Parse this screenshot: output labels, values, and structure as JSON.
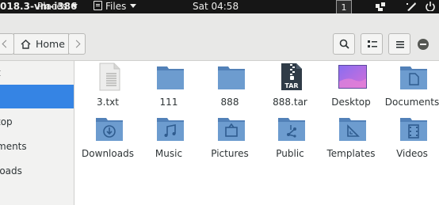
{
  "topbar": {
    "window_title": "018.3-vm-i386",
    "places_label": "Places",
    "files_label": "Files",
    "clock": "Sat 04:58",
    "workspace": "1"
  },
  "header": {
    "path_home": "Home"
  },
  "sidebar": {
    "items": [
      {
        "label": "t",
        "selected": false
      },
      {
        "label": "",
        "selected": true
      },
      {
        "label": "top",
        "selected": false
      },
      {
        "label": "ments",
        "selected": false
      },
      {
        "label": "loads",
        "selected": false
      }
    ]
  },
  "files": [
    {
      "name": "3.txt",
      "icon": "text-file-icon"
    },
    {
      "name": "111",
      "icon": "folder-icon"
    },
    {
      "name": "888",
      "icon": "folder-icon"
    },
    {
      "name": "888.tar",
      "icon": "tar-archive-icon"
    },
    {
      "name": "Desktop",
      "icon": "desktop-folder-icon"
    },
    {
      "name": "Documents",
      "icon": "documents-folder-icon"
    },
    {
      "name": "Downloads",
      "icon": "downloads-folder-icon"
    },
    {
      "name": "Music",
      "icon": "music-folder-icon"
    },
    {
      "name": "Pictures",
      "icon": "pictures-folder-icon"
    },
    {
      "name": "Public",
      "icon": "public-folder-icon"
    },
    {
      "name": "Templates",
      "icon": "templates-folder-icon"
    },
    {
      "name": "Videos",
      "icon": "videos-folder-icon"
    }
  ],
  "colors": {
    "folder": "#6d9ccf",
    "folder_tab": "#5281b8",
    "selection": "#3584e4"
  }
}
